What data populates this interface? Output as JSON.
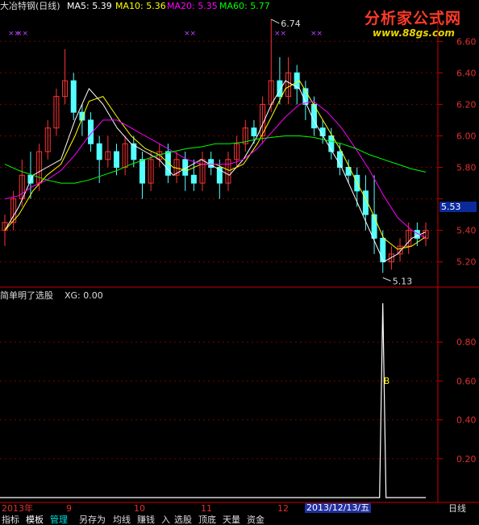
{
  "header": {
    "stock_name": "大冶特钢(日线)",
    "ma5": "MA5: 5.39",
    "ma10": "MA10: 5.36",
    "ma20": "MA20: 5.35",
    "ma60": "MA60: 5.77"
  },
  "logo": {
    "title": "分析家公式网",
    "url": "www.88gs.com"
  },
  "price_panel": {
    "y_ticks": [
      "6.60",
      "6.40",
      "6.20",
      "6.00",
      "5.80",
      "5.40",
      "5.20"
    ],
    "current_price": "5.53",
    "high_annotation": "6.74",
    "low_annotation": "5.13"
  },
  "indicator_panel": {
    "title": "简单明了选股",
    "xg": "XG: 0.00",
    "y_ticks": [
      "0.80",
      "0.60",
      "0.40",
      "0.20"
    ],
    "signal_label": "B"
  },
  "date_axis": {
    "labels": [
      "2013年",
      "9",
      "10",
      "11",
      "12"
    ],
    "cursor_date": "2013/12/13/五",
    "period": "日线"
  },
  "tabs": [
    "指标",
    "模板",
    "管理",
    "另存为",
    "均线",
    "赚钱",
    "入",
    "选股",
    "顶底",
    "天量",
    "资金"
  ],
  "colors": {
    "ma5": "#ffffff",
    "ma10": "#ffff00",
    "ma20": "#ff00ff",
    "ma60": "#00ff00",
    "up_candle": "#ff3333",
    "down_candle": "#54ffff",
    "axis_red": "#c80000"
  },
  "chart_data": {
    "type": "candlestick",
    "ylim": [
      5.05,
      6.75
    ],
    "ma_series": [
      {
        "name": "MA5",
        "values": [
          5.4,
          5.55,
          5.75,
          5.8,
          5.85,
          6.1,
          6.3,
          6.2,
          6.05,
          5.95,
          5.9,
          5.85,
          5.75,
          5.8,
          5.85,
          5.8,
          5.75,
          5.85,
          6.0,
          6.2,
          6.35,
          6.3,
          6.1,
          5.95,
          5.8,
          5.6,
          5.4,
          5.2,
          5.25,
          5.35,
          5.39
        ]
      },
      {
        "name": "MA10",
        "values": [
          5.4,
          5.5,
          5.65,
          5.75,
          5.82,
          6.0,
          6.22,
          6.25,
          6.12,
          6.0,
          5.92,
          5.88,
          5.8,
          5.78,
          5.82,
          5.82,
          5.78,
          5.82,
          5.95,
          6.12,
          6.3,
          6.35,
          6.2,
          6.05,
          5.9,
          5.72,
          5.55,
          5.35,
          5.28,
          5.3,
          5.36
        ]
      },
      {
        "name": "MA20",
        "values": [
          5.6,
          5.62,
          5.68,
          5.72,
          5.78,
          5.88,
          6.0,
          6.1,
          6.1,
          6.05,
          6.0,
          5.95,
          5.9,
          5.85,
          5.82,
          5.82,
          5.82,
          5.85,
          5.92,
          6.02,
          6.12,
          6.2,
          6.22,
          6.15,
          6.05,
          5.92,
          5.78,
          5.62,
          5.48,
          5.4,
          5.35
        ]
      },
      {
        "name": "MA60",
        "values": [
          5.82,
          5.78,
          5.75,
          5.72,
          5.7,
          5.7,
          5.72,
          5.75,
          5.78,
          5.82,
          5.85,
          5.88,
          5.9,
          5.92,
          5.93,
          5.95,
          5.95,
          5.96,
          5.98,
          5.99,
          6.0,
          6.0,
          5.99,
          5.97,
          5.95,
          5.92,
          5.88,
          5.85,
          5.82,
          5.79,
          5.77
        ]
      }
    ],
    "candles": [
      [
        5.4,
        5.45,
        5.3,
        5.5
      ],
      [
        5.45,
        5.6,
        5.4,
        5.65
      ],
      [
        5.6,
        5.75,
        5.55,
        5.85
      ],
      [
        5.75,
        5.7,
        5.6,
        5.9
      ],
      [
        5.7,
        5.9,
        5.65,
        5.95
      ],
      [
        5.9,
        6.05,
        5.85,
        6.1
      ],
      [
        6.05,
        6.25,
        6.0,
        6.3
      ],
      [
        6.25,
        6.35,
        6.2,
        6.55
      ],
      [
        6.35,
        6.15,
        6.1,
        6.4
      ],
      [
        6.15,
        6.1,
        6.0,
        6.2
      ],
      [
        6.1,
        5.95,
        5.9,
        6.15
      ],
      [
        5.95,
        5.85,
        5.7,
        6.0
      ],
      [
        5.85,
        5.9,
        5.8,
        6.0
      ],
      [
        5.9,
        5.8,
        5.75,
        5.95
      ],
      [
        5.8,
        5.95,
        5.75,
        6.0
      ],
      [
        5.95,
        5.85,
        5.8,
        6.0
      ],
      [
        5.85,
        5.7,
        5.6,
        5.9
      ],
      [
        5.7,
        5.85,
        5.65,
        5.9
      ],
      [
        5.85,
        5.9,
        5.8,
        5.95
      ],
      [
        5.9,
        5.75,
        5.7,
        5.95
      ],
      [
        5.75,
        5.85,
        5.7,
        5.9
      ],
      [
        5.85,
        5.75,
        5.65,
        5.9
      ],
      [
        5.75,
        5.7,
        5.65,
        5.85
      ],
      [
        5.7,
        5.85,
        5.65,
        5.9
      ],
      [
        5.85,
        5.8,
        5.75,
        5.9
      ],
      [
        5.8,
        5.7,
        5.6,
        5.85
      ],
      [
        5.7,
        5.85,
        5.65,
        5.9
      ],
      [
        5.85,
        5.95,
        5.8,
        6.0
      ],
      [
        5.95,
        6.05,
        5.9,
        6.1
      ],
      [
        6.05,
        6.0,
        5.95,
        6.1
      ],
      [
        6.0,
        6.2,
        5.95,
        6.25
      ],
      [
        6.2,
        6.35,
        6.15,
        6.74
      ],
      [
        6.35,
        6.25,
        6.2,
        6.5
      ],
      [
        6.25,
        6.4,
        6.2,
        6.5
      ],
      [
        6.4,
        6.3,
        6.2,
        6.45
      ],
      [
        6.3,
        6.2,
        6.1,
        6.35
      ],
      [
        6.2,
        6.05,
        6.0,
        6.25
      ],
      [
        6.05,
        6.0,
        5.95,
        6.1
      ],
      [
        6.0,
        5.9,
        5.85,
        6.05
      ],
      [
        5.9,
        5.8,
        5.75,
        5.95
      ],
      [
        5.8,
        5.75,
        5.7,
        5.85
      ],
      [
        5.75,
        5.65,
        5.55,
        5.8
      ],
      [
        5.65,
        5.5,
        5.4,
        5.75
      ],
      [
        5.5,
        5.35,
        5.25,
        5.75
      ],
      [
        5.35,
        5.2,
        5.13,
        5.4
      ],
      [
        5.2,
        5.25,
        5.15,
        5.3
      ],
      [
        5.25,
        5.3,
        5.2,
        5.35
      ],
      [
        5.3,
        5.4,
        5.25,
        5.45
      ],
      [
        5.4,
        5.35,
        5.3,
        5.45
      ],
      [
        5.35,
        5.4,
        5.3,
        5.45
      ]
    ],
    "indicator": {
      "name": "XG",
      "signal_index": 44,
      "signal_value": 1.0
    }
  }
}
